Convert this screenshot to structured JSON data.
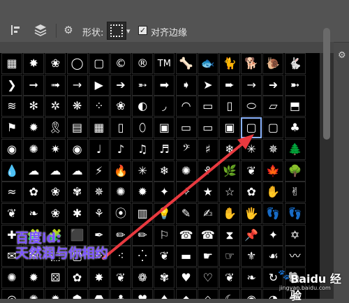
{
  "toolbar": {
    "align_icon": "align-edges-icon",
    "arrange_icon": "arrange-layers-icon",
    "settings_icon": "gear-icon",
    "shape_label": "形状:",
    "align_edges_label": "对齐边缘",
    "align_edges_checked": true
  },
  "shape_grid": {
    "shapes": [
      [
        "▦",
        "✸",
        "❀",
        "◯",
        "▢",
        "©",
        "®",
        "TM",
        "🦴",
        "🐟",
        "🐈",
        "🐕",
        "🐌",
        "🐇"
      ],
      [
        "❯",
        "➞",
        "➟",
        "→",
        "▶",
        "➔",
        "➵",
        "➡",
        "➧",
        "➤",
        "➨",
        "→",
        "➜",
        "➼"
      ],
      [
        "≋",
        "✻",
        "✲",
        "❋",
        "⁘",
        "❀",
        "◐",
        "◞",
        "◠",
        "▭",
        "▯",
        "⬭",
        "▱",
        "⬒"
      ],
      [
        "⚑",
        "✹",
        "🎗",
        "▤",
        "▦",
        "▯",
        "⬯",
        "▣",
        "▭",
        "▭",
        "▣",
        "▢",
        "▢",
        "♣"
      ],
      [
        "◉",
        "✺",
        "✷",
        "◉",
        "♩",
        "♪",
        "♫",
        "♬",
        "𝄢",
        "♯",
        "❄",
        "✳",
        "✵",
        "🌲"
      ],
      [
        "💧",
        "☁",
        "☁",
        "☁",
        "⚡",
        "🔥",
        "✳",
        "❄",
        "✺",
        "⚘",
        "🌿",
        "❦",
        "🍁",
        "🌳"
      ],
      [
        "≈",
        "✿",
        "❀",
        "✾",
        "✵",
        "✺",
        "✹",
        "✦",
        "✧",
        "★",
        "☆",
        "✿",
        "✋",
        "✌"
      ],
      [
        "❦",
        "❧",
        "❀",
        "✱",
        "⚘",
        "⦿",
        "▥",
        "💡",
        "✎",
        "✍",
        "✋",
        "🖐",
        "👣",
        "👣"
      ],
      [
        "✚",
        "🧩",
        "🧩",
        "⬛",
        "✒",
        "✏",
        "✏",
        "⚐",
        "☎",
        "☎",
        "⧗",
        "📌",
        "✦",
        "✡"
      ],
      [
        "✉",
        "✉",
        "⬚",
        "▢",
        "⁘",
        "⁖",
        "⁛",
        "❦",
        "▬",
        "☛",
        "☞",
        "⚜",
        "☙",
        "〰"
      ],
      [
        "✺",
        "✹",
        "⚄",
        "✿",
        "✸",
        "❦",
        "❁",
        "✾",
        "♥",
        "♡",
        "❦",
        "❧",
        "↻",
        "🐘"
      ],
      [
        "◎",
        "✺",
        "✹",
        "⬢",
        "⬣",
        "♣",
        "♥",
        "♠",
        "◆",
        "◇",
        "☾",
        "◉",
        "◑",
        "⬤"
      ]
    ],
    "selected_shape": "▣"
  },
  "overlay": {
    "watermark_lines": [
      "百度id:",
      "天然润与你相约"
    ],
    "logo_main": "Baidu 经验",
    "logo_sub": "jingyan.baidu.com",
    "arrow_color": "#e8393f"
  }
}
